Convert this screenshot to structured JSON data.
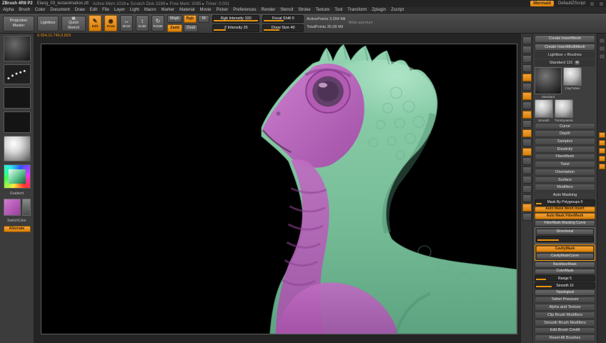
{
  "colors": {
    "accent": "#e8920c",
    "body_green": "#76bd97",
    "body_purple": "#b05eb4"
  },
  "title_bar": {
    "app": "ZBrush 4R8 P2",
    "doc": "Elang_03_testanimation.ztl",
    "stats": "Active Mem 1016 ▸ Scratch Disk 3289 ▸ Free Mem: 3085 ▸ Timer: 0.001",
    "script_chip": "Mermaid",
    "script_name": "DefaultZScript"
  },
  "menu": {
    "items": [
      "Alpha",
      "Brush",
      "Color",
      "Document",
      "Draw",
      "Edit",
      "File",
      "Layer",
      "Light",
      "Macro",
      "Marker",
      "Material",
      "Movie",
      "Picker",
      "Preferences",
      "Render",
      "Stencil",
      "Stroke",
      "Texture",
      "Tool",
      "Transform",
      "Zplugin",
      "Zscript"
    ]
  },
  "shelf": {
    "projection_master": "Projection Master",
    "lightbox": "Lightbox",
    "quick_sketch": "Quick Sketch",
    "edit": "Edit",
    "draw": "Draw",
    "move": "Move",
    "scale": "Scale",
    "rotate": "Rotate",
    "mrgb": "Mrgb",
    "rgb": "Rgb",
    "m": "M",
    "rgb_intensity": "Rgb Intensity 100",
    "zadd": "Zadd",
    "zsub": "Zsub",
    "z_intensity": "Z Intensity 25",
    "focal_shift": "Focal Shift 0",
    "draw_size": "Draw Size 40",
    "active_points": "ActivePoints 3.294 Mil",
    "total_points": "TotalPoints 35.08 Mil",
    "aperture": "Wide aperture"
  },
  "icons": {
    "edit_glyph": "✎",
    "draw_glyph": "◉",
    "move_glyph": "↔",
    "scale_glyph": "↕",
    "rotate_glyph": "↻",
    "quick_sketch_glyph": "▦"
  },
  "position_readout": "0.054,11.745,0.829",
  "left_shelf": {
    "gradient_label": "Gradient",
    "switch_color": "SwitchColor",
    "alternate": "Alternate"
  },
  "right_shelf": {
    "icons": [
      "bpr-icon",
      "render-icon",
      "polyframe-icon",
      "persp-icon",
      "floor-icon",
      "local-icon",
      "lsym-icon",
      "frame-icon",
      "move-doc-icon",
      "scale-doc-icon",
      "rotate-doc-icon",
      "zoom-icon",
      "actual-icon",
      "aahalf-icon",
      "scroll-icon",
      "zoomdoc-icon",
      "fit-icon",
      "prev-icon",
      "next-icon",
      "xyz-icon"
    ]
  },
  "tool_panel": {
    "create_insertmesh": "Create InsertMesh",
    "create_insertmultimesh": "Create InsertMultiMesh",
    "lightbox_brushes": "Lightbox » Brushes",
    "brush_name": "Standard 115",
    "r_toggle": "R",
    "thumbs": {
      "current": "Standard",
      "t1": "ClayTubes",
      "t2": "Smooth",
      "t3": "TrimDynamic"
    },
    "sections": [
      "Curve",
      "Depth",
      "Samples",
      "Elasticity",
      "FiberMesh",
      "Twist",
      "Orientation",
      "Surface",
      "Modifiers"
    ],
    "auto_masking": {
      "header": "Auto Masking",
      "mask_by_polygroups": "Mask By Polygroups 0",
      "auto_mask_mesh_insert": "Auto Mask Mesh Insert",
      "auto_mask_fibermesh": "Auto Mask FiberMesh",
      "fibermask_masking_curve": "FiberMask Masking Curve",
      "directional": "Directional",
      "cavity_mask": "CavityMask",
      "cavity_mask_curve": "CavityMaskCurve",
      "backface_mask": "BackfaceMask",
      "color_mask": "ColorMask",
      "range": "Range 5",
      "smooth": "Smooth 10",
      "topological": "Topological"
    },
    "bottom_sections": [
      "Tablet Pressure",
      "Alpha and Texture",
      "Clip Brush Modifiers",
      "Smooth Brush Modifiers",
      "Edit Brush Credit",
      "Reset All Brushes"
    ]
  }
}
